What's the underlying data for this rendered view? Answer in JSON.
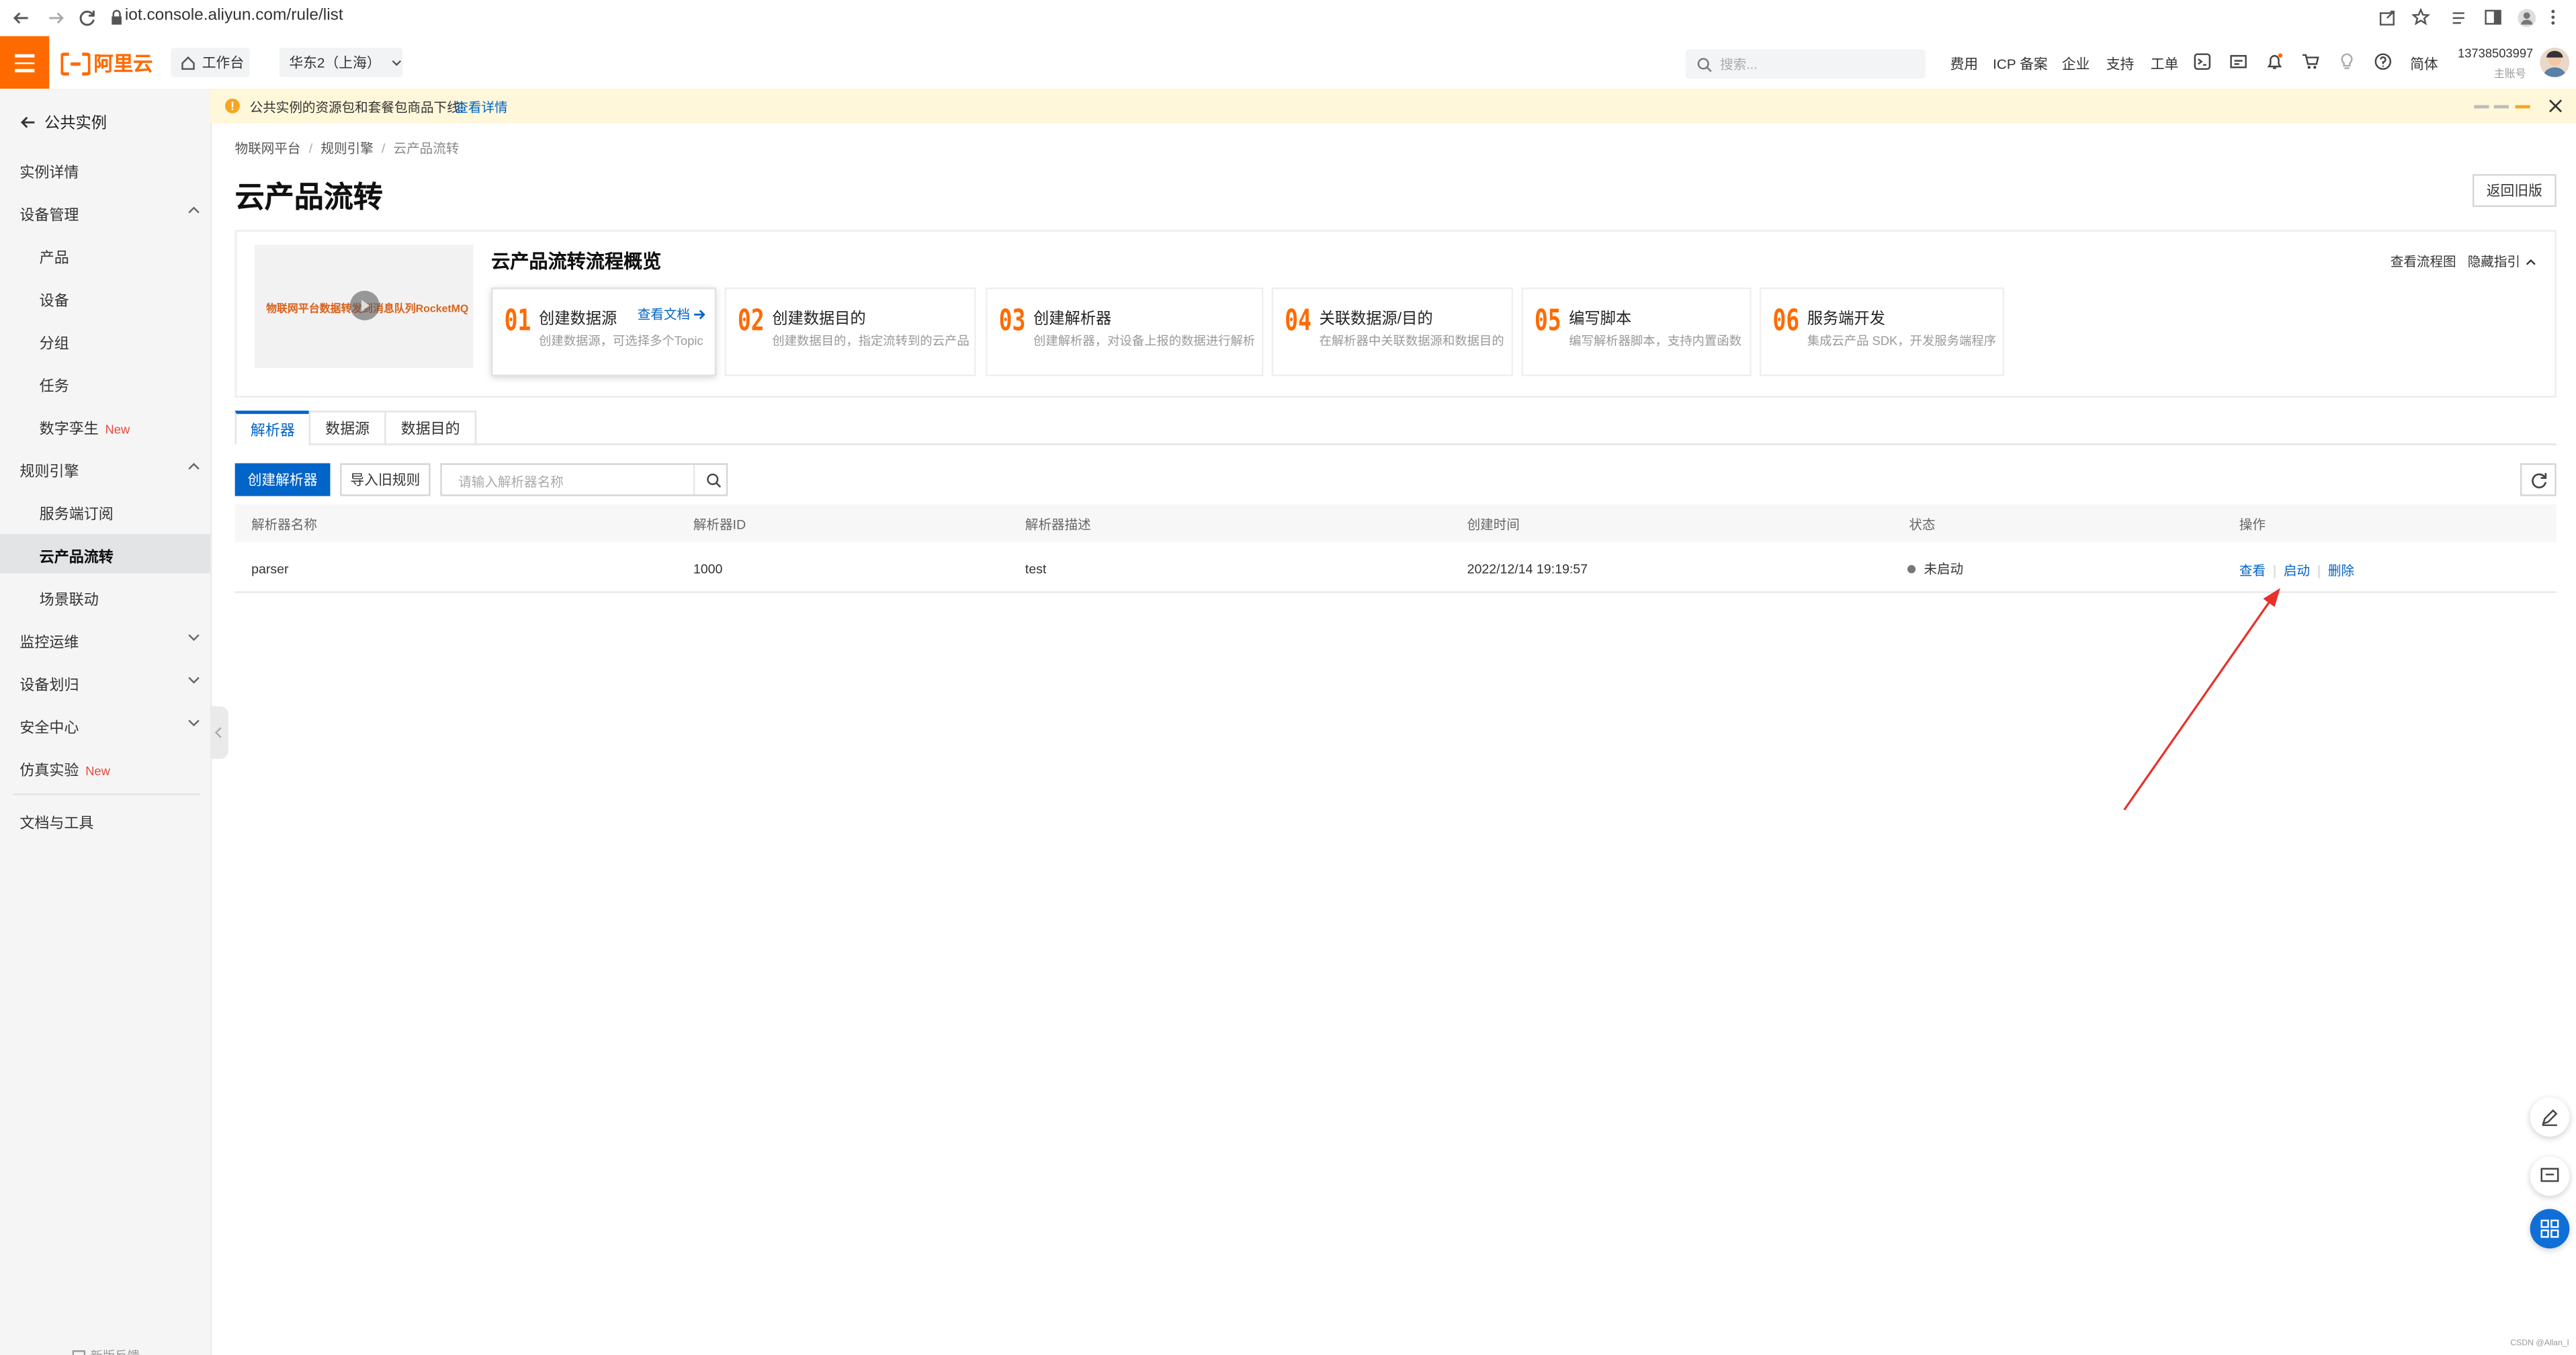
{
  "browser": {
    "url": "iot.console.aliyun.com/rule/list"
  },
  "topnav": {
    "logo": "阿里云",
    "workbench": "工作台",
    "region": "华东2（上海）",
    "search_placeholder": "搜索...",
    "links": [
      "费用",
      "ICP 备案",
      "企业",
      "支持",
      "工单"
    ],
    "lang": "简体",
    "account_id": "13738503997",
    "account_role": "主账号"
  },
  "sidebar": {
    "back_label": "公共实例",
    "items": [
      {
        "label": "实例详情"
      },
      {
        "label": "设备管理"
      },
      {
        "label": "产品"
      },
      {
        "label": "设备"
      },
      {
        "label": "分组"
      },
      {
        "label": "任务"
      },
      {
        "label": "数字孪生",
        "tag": "New"
      },
      {
        "label": "规则引擎"
      },
      {
        "label": "服务端订阅"
      },
      {
        "label": "云产品流转"
      },
      {
        "label": "场景联动"
      },
      {
        "label": "监控运维"
      },
      {
        "label": "设备划归"
      },
      {
        "label": "安全中心"
      },
      {
        "label": "仿真实验",
        "tag": "New"
      },
      {
        "label": "文档与工具"
      }
    ],
    "footer": "新版反馈"
  },
  "notice": {
    "text": "公共实例的资源包和套餐包商品下线!",
    "link": "查看详情"
  },
  "breadcrumb": [
    "物联网平台",
    "规则引擎",
    "云产品流转"
  ],
  "page": {
    "title": "云产品流转",
    "back_old_btn": "返回旧版"
  },
  "guide": {
    "video_caption": "物联网平台数据转发到消息队列RocketMQ",
    "title": "云产品流转流程概览",
    "view_flow": "查看流程图",
    "hide_guide": "隐藏指引",
    "steps": [
      {
        "num": "01",
        "title": "创建数据源",
        "desc": "创建数据源，可选择多个Topic",
        "link": "查看文档"
      },
      {
        "num": "02",
        "title": "创建数据目的",
        "desc": "创建数据目的，指定流转到的云产品"
      },
      {
        "num": "03",
        "title": "创建解析器",
        "desc": "创建解析器，对设备上报的数据进行解析"
      },
      {
        "num": "04",
        "title": "关联数据源/目的",
        "desc": "在解析器中关联数据源和数据目的"
      },
      {
        "num": "05",
        "title": "编写脚本",
        "desc": "编写解析器脚本，支持内置函数"
      },
      {
        "num": "06",
        "title": "服务端开发",
        "desc": "集成云产品 SDK，开发服务端程序"
      }
    ]
  },
  "tabs": [
    "解析器",
    "数据源",
    "数据目的"
  ],
  "toolbar": {
    "create_btn": "创建解析器",
    "import_btn": "导入旧规则",
    "search_placeholder": "请输入解析器名称"
  },
  "table": {
    "headers": [
      "解析器名称",
      "解析器ID",
      "解析器描述",
      "创建时间",
      "状态",
      "操作"
    ],
    "rows": [
      {
        "name": "parser",
        "id": "1000",
        "desc": "test",
        "created": "2022/12/14 19:19:57",
        "status": "未启动",
        "actions": [
          "查看",
          "启动",
          "删除"
        ]
      }
    ]
  },
  "watermark": "CSDN @Allan_l",
  "colors": {
    "brand": "#ff6a00",
    "primary": "#0064c8",
    "annotation": "#e8302a"
  }
}
